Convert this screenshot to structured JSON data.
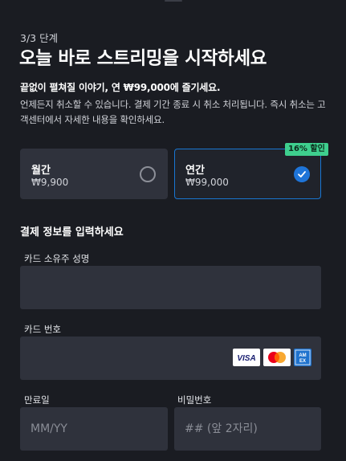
{
  "header": {
    "step": "3/3 단계",
    "title": "오늘 바로 스트리밍을 시작하세요",
    "subtitle": "끝없이 펼쳐질 이야기, 연 ₩99,000에 즐기세요.",
    "description": "언제든지 취소할 수 있습니다. 결제 기간 종료 시 취소 처리됩니다. 즉시 취소는 고객센터에서 자세한 내용을 확인하세요."
  },
  "plans": [
    {
      "name": "월간",
      "price": "₩9,900",
      "selected": false
    },
    {
      "name": "연간",
      "price": "₩99,000",
      "selected": true
    }
  ],
  "discount_badge": "16% 할인",
  "payment": {
    "section_title": "결제 정보를 입력하세요",
    "cardholder_label": "카드 소유주 성명",
    "card_number_label": "카드 번호",
    "expiry_label": "만료일",
    "expiry_placeholder": "MM/YY",
    "cvc_label": "비밀번호",
    "cvc_placeholder": "## (앞 2자리)"
  },
  "card_brands": [
    "VISA",
    "Mastercard",
    "AMEX"
  ],
  "colors": {
    "background": "#1a1c22",
    "field_background": "#2f323c",
    "accent_blue": "#1e74d8",
    "badge_green": "#3ecf8e"
  }
}
